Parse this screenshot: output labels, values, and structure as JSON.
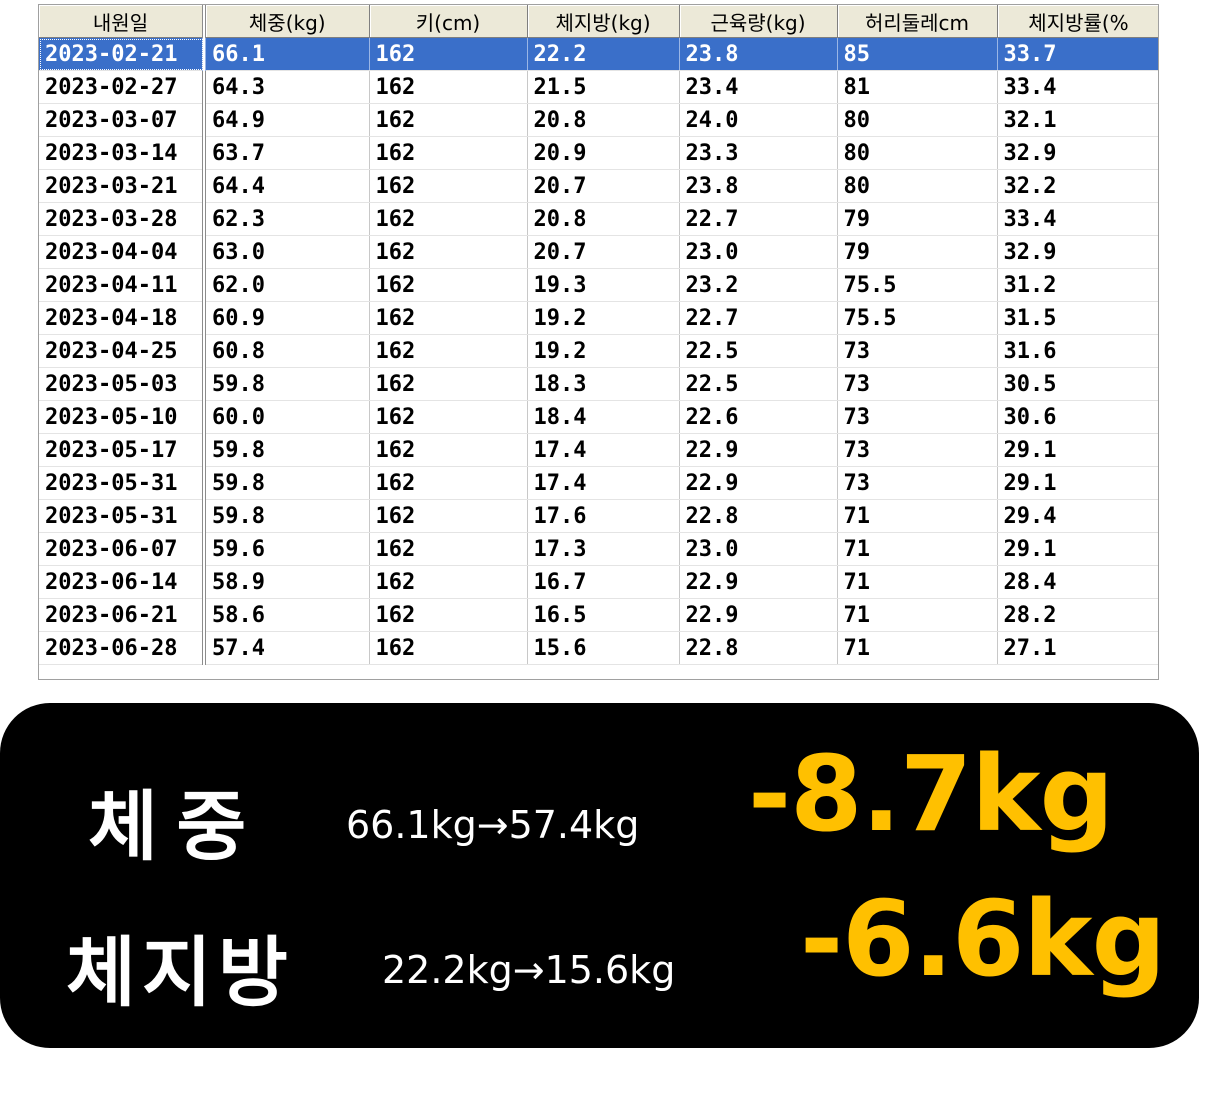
{
  "table": {
    "columns": [
      "내원일",
      "체중(kg)",
      "키(cm)",
      "체지방(kg)",
      "근육량(kg)",
      "허리둘레cm",
      "체지방률(%"
    ],
    "selected_row": 0,
    "rows": [
      [
        "2023-02-21",
        "66.1",
        "162",
        "22.2",
        "23.8",
        "85",
        "33.7"
      ],
      [
        "2023-02-27",
        "64.3",
        "162",
        "21.5",
        "23.4",
        "81",
        "33.4"
      ],
      [
        "2023-03-07",
        "64.9",
        "162",
        "20.8",
        "24.0",
        "80",
        "32.1"
      ],
      [
        "2023-03-14",
        "63.7",
        "162",
        "20.9",
        "23.3",
        "80",
        "32.9"
      ],
      [
        "2023-03-21",
        "64.4",
        "162",
        "20.7",
        "23.8",
        "80",
        "32.2"
      ],
      [
        "2023-03-28",
        "62.3",
        "162",
        "20.8",
        "22.7",
        "79",
        "33.4"
      ],
      [
        "2023-04-04",
        "63.0",
        "162",
        "20.7",
        "23.0",
        "79",
        "32.9"
      ],
      [
        "2023-04-11",
        "62.0",
        "162",
        "19.3",
        "23.2",
        "75.5",
        "31.2"
      ],
      [
        "2023-04-18",
        "60.9",
        "162",
        "19.2",
        "22.7",
        "75.5",
        "31.5"
      ],
      [
        "2023-04-25",
        "60.8",
        "162",
        "19.2",
        "22.5",
        "73",
        "31.6"
      ],
      [
        "2023-05-03",
        "59.8",
        "162",
        "18.3",
        "22.5",
        "73",
        "30.5"
      ],
      [
        "2023-05-10",
        "60.0",
        "162",
        "18.4",
        "22.6",
        "73",
        "30.6"
      ],
      [
        "2023-05-17",
        "59.8",
        "162",
        "17.4",
        "22.9",
        "73",
        "29.1"
      ],
      [
        "2023-05-31",
        "59.8",
        "162",
        "17.4",
        "22.9",
        "73",
        "29.1"
      ],
      [
        "2023-05-31",
        "59.8",
        "162",
        "17.6",
        "22.8",
        "71",
        "29.4"
      ],
      [
        "2023-06-07",
        "59.6",
        "162",
        "17.3",
        "23.0",
        "71",
        "29.1"
      ],
      [
        "2023-06-14",
        "58.9",
        "162",
        "16.7",
        "22.9",
        "71",
        "28.4"
      ],
      [
        "2023-06-21",
        "58.6",
        "162",
        "16.5",
        "22.9",
        "71",
        "28.2"
      ],
      [
        "2023-06-28",
        "57.4",
        "162",
        "15.6",
        "22.8",
        "71",
        "27.1"
      ]
    ]
  },
  "summary": {
    "weight": {
      "label": "체  중",
      "range": "66.1kg→57.4kg",
      "delta": "-8.7kg"
    },
    "fat": {
      "label": "체지방",
      "range": "22.2kg→15.6kg",
      "delta": "-6.6kg"
    }
  },
  "colors": {
    "selection": "#3a6fc9",
    "panel": "#000000",
    "highlight": "#ffc000"
  }
}
